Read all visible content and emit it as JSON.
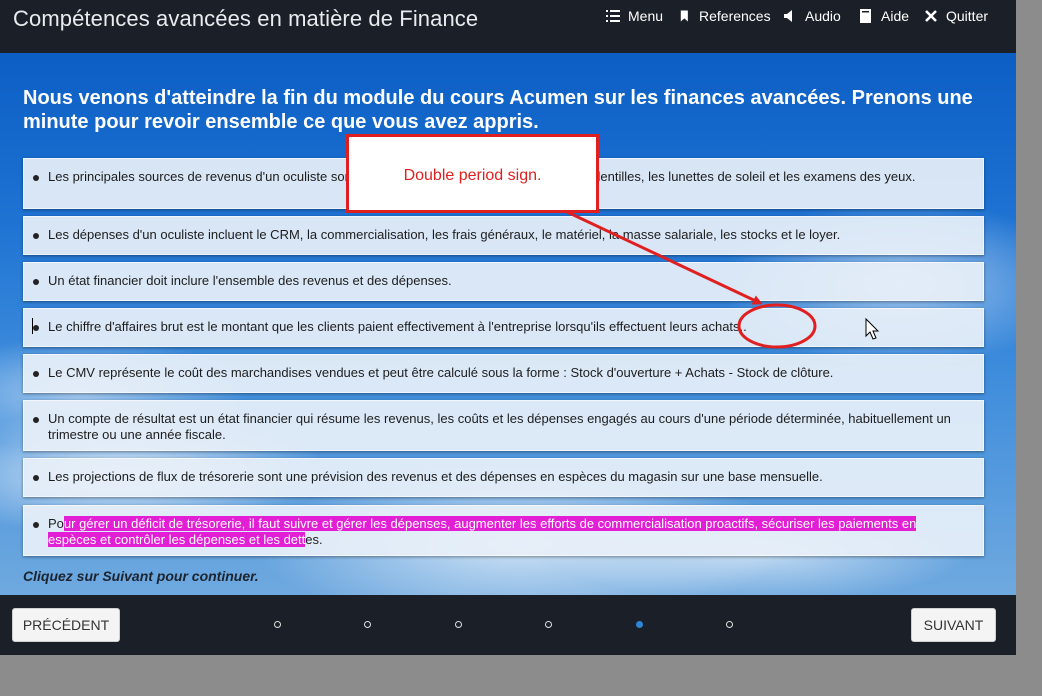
{
  "header": {
    "course_title": "Compétences avancées en matière de Finance",
    "nav": [
      {
        "label": "Menu",
        "icon": "menu-icon"
      },
      {
        "label": "References",
        "icon": "bookmark-icon"
      },
      {
        "label": "Audio",
        "icon": "speaker-icon"
      },
      {
        "label": "Aide",
        "icon": "book-icon"
      },
      {
        "label": "Quitter",
        "icon": "close-icon"
      }
    ]
  },
  "main": {
    "heading": "Nous venons d'atteindre la fin du module du cours Acumen sur les finances avancées. Prenons une minute pour revoir ensemble ce que vous avez appris.",
    "items": [
      "Les principales sources de revenus d'un oculiste sont les examens de la vue, les montures, les lentilles, les lunettes de soleil et les examens des yeux.",
      "Les dépenses d'un oculiste incluent le CRM, la commercialisation, les frais généraux, le matériel, la masse salariale, les stocks et le loyer.",
      "Un état financier doit inclure l'ensemble des revenus et des dépenses.",
      "Le chiffre d'affaires brut est le montant que les clients paient effectivement à l'entreprise lorsqu'ils effectuent leurs achats..",
      "Le CMV représente le coût des marchandises vendues et peut être calculé sous la forme : Stock d'ouverture + Achats - Stock de clôture.",
      "Un compte de résultat est un état financier qui résume les revenus, les coûts et les dépenses engagés au cours d'une période déterminée, habituellement un trimestre ou une année fiscale.",
      "Les projections de flux de trésorerie sont une prévision des revenus et des dépenses en espèces du magasin sur une base mensuelle."
    ],
    "last_item": {
      "before": "Po",
      "highlighted": "ur gérer un déficit de trésorerie, il faut suivre et gérer les dépenses, augmenter les efforts de commercialisation proactifs, sécuriser les paiements en espèces et contrôler les dépenses et les dett",
      "after": "es."
    },
    "cta": "Cliquez sur Suivant pour continuer."
  },
  "footer": {
    "prev_label": "PRÉCÉDENT",
    "next_label": "SUIVANT",
    "pages_total": 6,
    "current_page": 5
  },
  "annotation": {
    "callout_text": "Double period sign.",
    "color": "#e02020"
  }
}
